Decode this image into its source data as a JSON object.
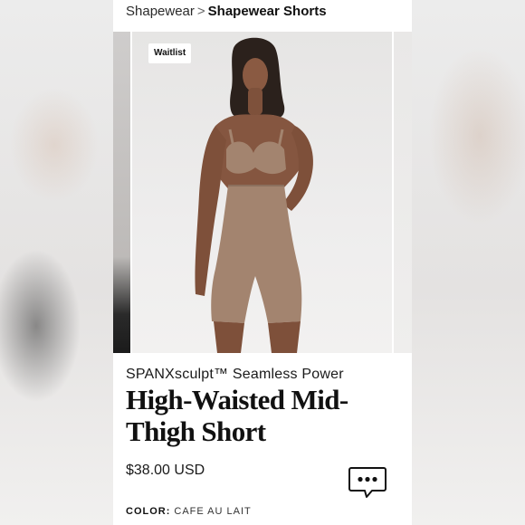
{
  "breadcrumb": {
    "parent": "Shapewear",
    "separator": ">",
    "current": "Shapewear Shorts"
  },
  "gallery": {
    "badge": "Waitlist",
    "image_alt": "Model wearing high-waisted mid-thigh short in cafe au lait"
  },
  "product": {
    "subtitle": "SPANXsculpt™ Seamless Power",
    "title": "High-Waisted Mid-Thigh Short",
    "price": "$38.00 USD",
    "color_label": "COLOR:",
    "color_value": "CAFE AU LAIT"
  },
  "icons": {
    "chat": "chat-bubble-icon"
  },
  "colors": {
    "product_tone": "#a3846f",
    "text": "#1a1a1a",
    "background": "#ffffff"
  }
}
